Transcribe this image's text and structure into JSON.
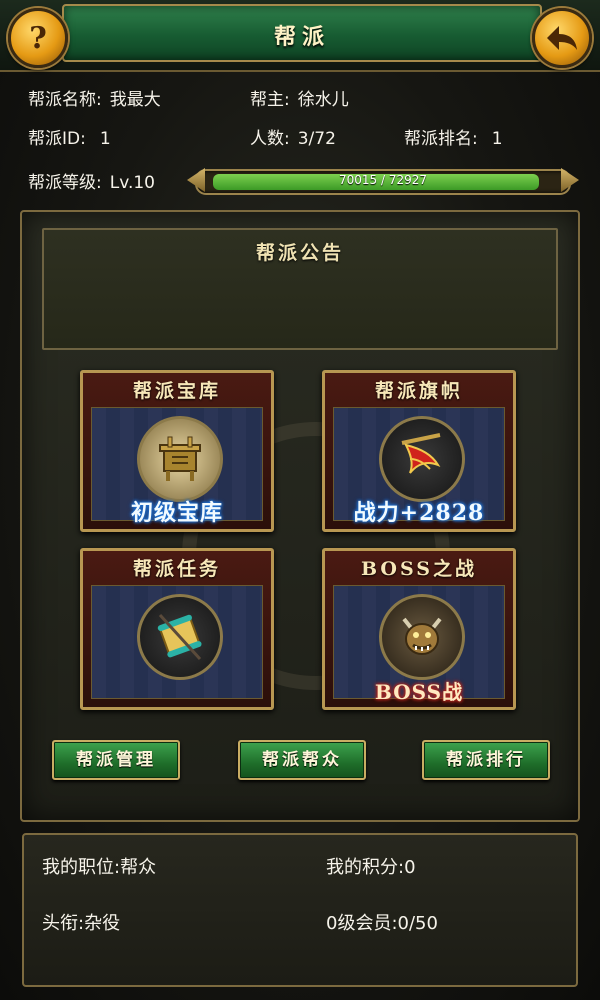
{
  "header": {
    "title": "帮派"
  },
  "info": {
    "name_label": "帮派名称:",
    "name_value": "我最大",
    "leader_label": "帮主:",
    "leader_value": "徐水儿",
    "id_label": "帮派ID:",
    "id_value": "1",
    "members_label": "人数:",
    "members_value": "3/72",
    "rank_label": "帮派排名:",
    "rank_value": "1",
    "level_label": "帮派等级:",
    "level_value": "Lv.10",
    "exp_text": "70015 / 72927",
    "exp_current": 70015,
    "exp_max": 72927
  },
  "notice": {
    "title": "帮派公告"
  },
  "cards": [
    {
      "title": "帮派宝库",
      "caption": "初级宝库",
      "icon": "treasure-cauldron-icon"
    },
    {
      "title": "帮派旗帜",
      "caption": "战力+2828",
      "icon": "banner-flag-icon"
    },
    {
      "title": "帮派任务",
      "caption": "",
      "icon": "scroll-task-icon"
    },
    {
      "title": "BOSS之战",
      "caption": "BOSS战",
      "icon": "boss-monster-icon"
    }
  ],
  "buttons": {
    "manage": "帮派管理",
    "members": "帮派帮众",
    "ranking": "帮派排行"
  },
  "me": {
    "position": "我的职位:帮众",
    "points": "我的积分:0",
    "title": "头衔:杂役",
    "membership": "0级会员:0/50"
  },
  "colors": {
    "accent_gold": "#b89752",
    "button_green": "#2f8a3c",
    "progress_green": "#5cb83a",
    "card_red": "#4a1a12"
  }
}
